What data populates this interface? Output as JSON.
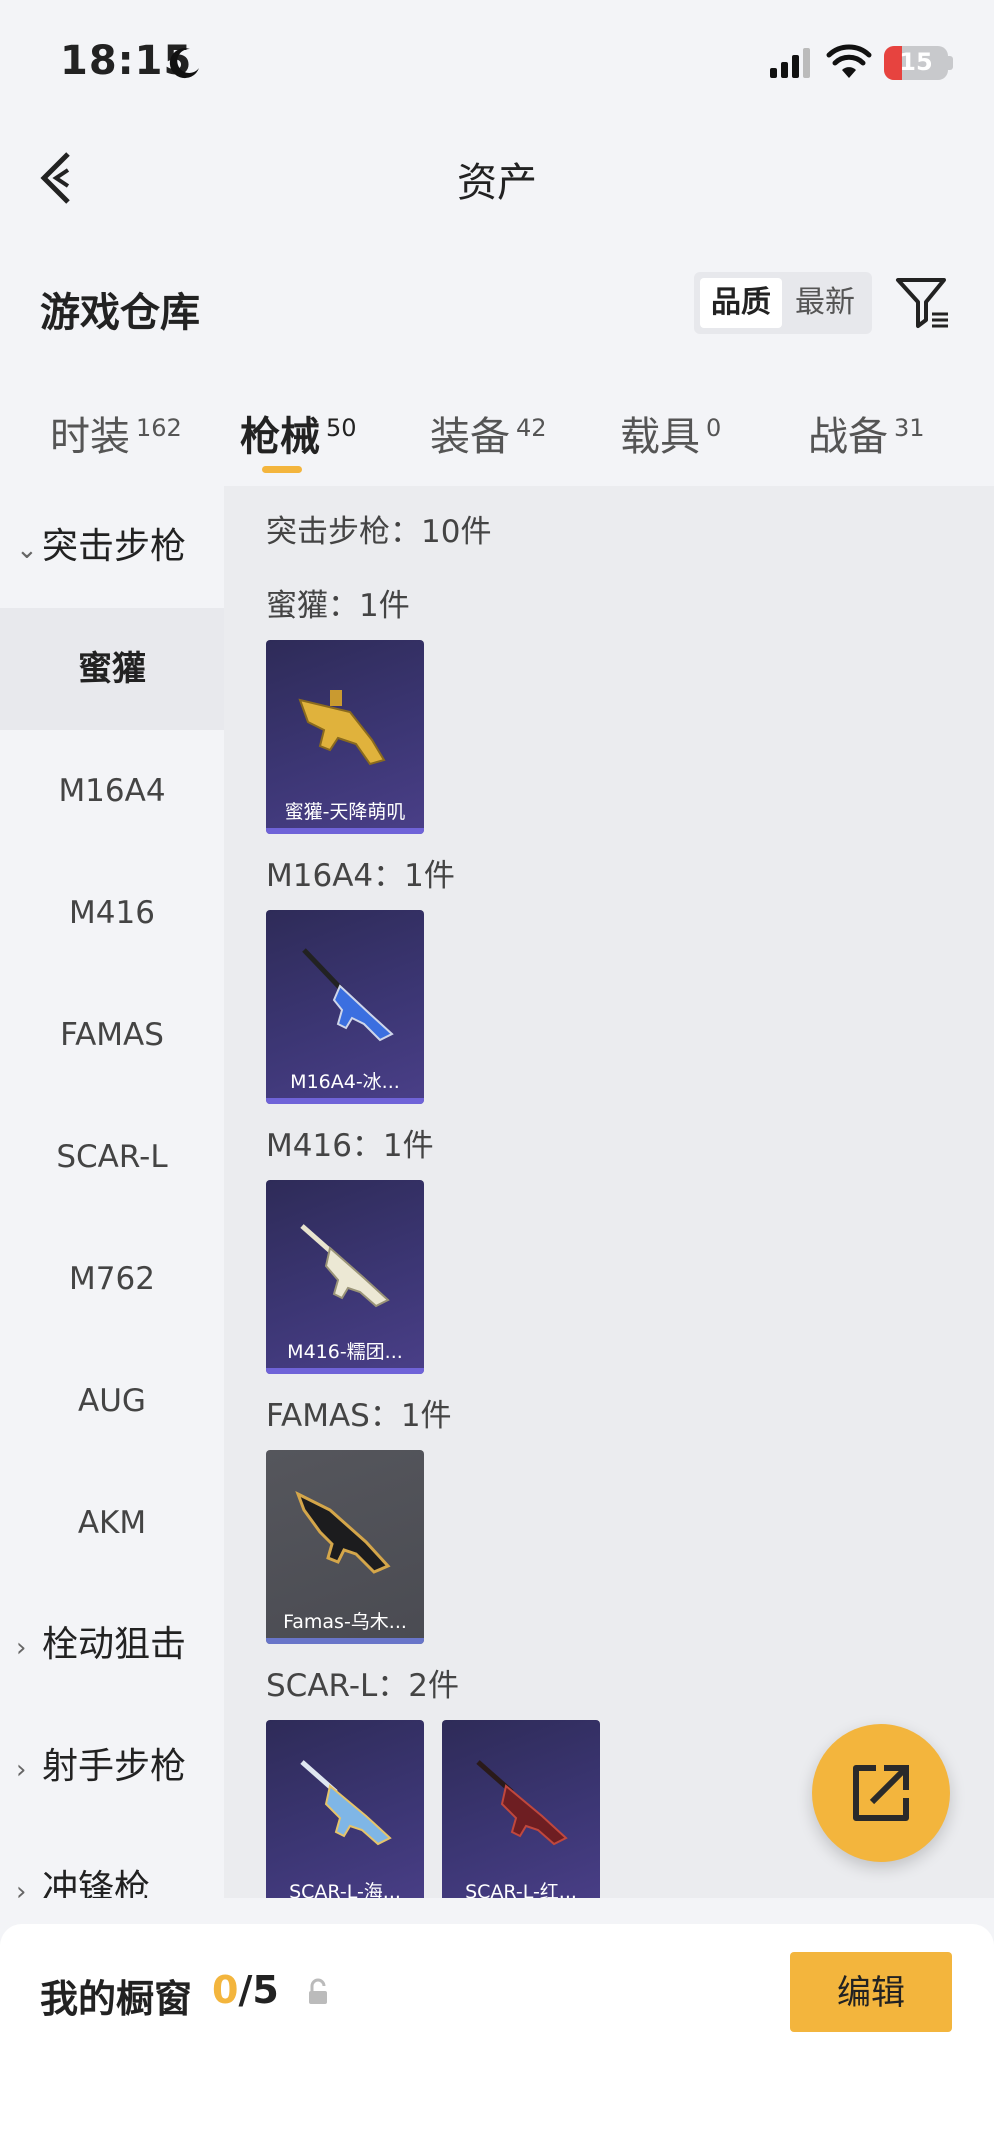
{
  "status": {
    "time": "18:15",
    "battery": "15"
  },
  "nav": {
    "title": "资产"
  },
  "section": {
    "title": "游戏仓库",
    "sort_options": [
      "品质",
      "最新"
    ]
  },
  "tabs": [
    {
      "label": "时装",
      "count": "162"
    },
    {
      "label": "枪械",
      "count": "50"
    },
    {
      "label": "装备",
      "count": "42"
    },
    {
      "label": "载具",
      "count": "0"
    },
    {
      "label": "战备",
      "count": "31"
    }
  ],
  "sidebar": {
    "categories": [
      {
        "label": "突击步枪",
        "expanded": true
      },
      {
        "label": "栓动狙击",
        "expanded": false
      },
      {
        "label": "射手步枪",
        "expanded": false
      },
      {
        "label": "冲锋枪",
        "expanded": false
      }
    ],
    "subcategories": [
      "蜜獾",
      "M16A4",
      "M416",
      "FAMAS",
      "SCAR-L",
      "M762",
      "AUG",
      "AKM"
    ]
  },
  "content": {
    "summary": "突击步枪：10件",
    "groups": [
      {
        "label": "蜜獾：1件",
        "items": [
          {
            "name": "蜜獾-天降萌叽",
            "rarity": "purple",
            "icon": "gold-smg-icon"
          }
        ]
      },
      {
        "label": "M16A4：1件",
        "items": [
          {
            "name": "M16A4-冰...",
            "rarity": "purple",
            "icon": "blue-rifle-icon"
          }
        ]
      },
      {
        "label": "M416：1件",
        "items": [
          {
            "name": "M416-糯团...",
            "rarity": "purple",
            "icon": "white-rifle-icon"
          }
        ]
      },
      {
        "label": "FAMAS：1件",
        "items": [
          {
            "name": "Famas-乌木...",
            "rarity": "gray",
            "icon": "black-gold-rifle-icon"
          }
        ]
      },
      {
        "label": "SCAR-L：2件",
        "items": [
          {
            "name": "SCAR-L-海...",
            "rarity": "purple",
            "icon": "ocean-rifle-icon"
          },
          {
            "name": "SCAR-L-红...",
            "rarity": "purple",
            "icon": "red-rifle-icon"
          }
        ]
      }
    ]
  },
  "showcase": {
    "label": "我的橱窗",
    "current": "0",
    "total": "/5",
    "edit_label": "编辑"
  },
  "colors": {
    "accent": "#f3b53d",
    "purple_card": "#3c3674",
    "gray_card": "#4a4b52"
  }
}
